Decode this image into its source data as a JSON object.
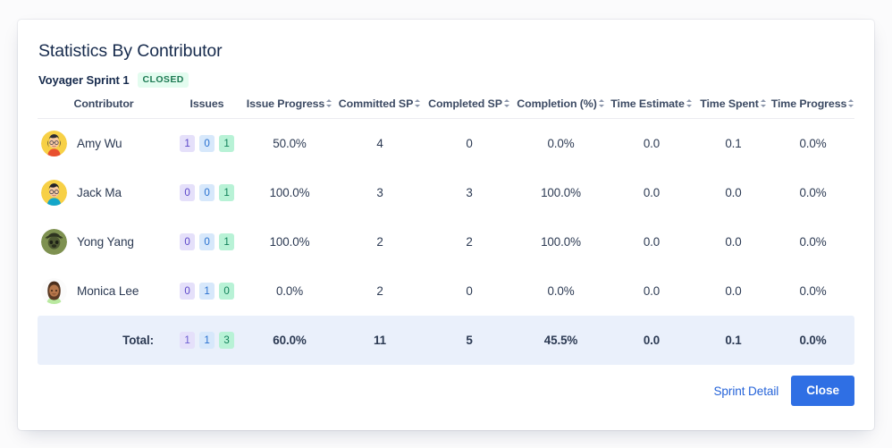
{
  "modal": {
    "title": "Statistics By Contributor",
    "sprint_name": "Voyager Sprint 1",
    "status_badge": "CLOSED",
    "status_badge_bg": "#e3fcef",
    "status_badge_color": "#1d7a53"
  },
  "table": {
    "columns": [
      {
        "label": "Contributor",
        "sortable": false
      },
      {
        "label": "Issues",
        "sortable": false
      },
      {
        "label": "Issue Progress",
        "sortable": true
      },
      {
        "label": "Committed SP",
        "sortable": true
      },
      {
        "label": "Completed SP",
        "sortable": true
      },
      {
        "label": "Completion (%)",
        "sortable": true
      },
      {
        "label": "Time Estimate",
        "sortable": true
      },
      {
        "label": "Time Spent",
        "sortable": true
      },
      {
        "label": "Time Progress",
        "sortable": true
      }
    ],
    "rows": [
      {
        "name": "Amy Wu",
        "avatar": "avatar-amy-wu",
        "issues": {
          "todo": "1",
          "in_progress": "0",
          "done": "1"
        },
        "issue_progress": "50.0%",
        "committed_sp": "4",
        "completed_sp": "0",
        "completion_pct": "0.0%",
        "time_estimate": "0.0",
        "time_spent": "0.1",
        "time_progress": "0.0%"
      },
      {
        "name": "Jack Ma",
        "avatar": "avatar-jack-ma",
        "issues": {
          "todo": "0",
          "in_progress": "0",
          "done": "1"
        },
        "issue_progress": "100.0%",
        "committed_sp": "3",
        "completed_sp": "3",
        "completion_pct": "100.0%",
        "time_estimate": "0.0",
        "time_spent": "0.0",
        "time_progress": "0.0%"
      },
      {
        "name": "Yong Yang",
        "avatar": "avatar-yong-yang",
        "issues": {
          "todo": "0",
          "in_progress": "0",
          "done": "1"
        },
        "issue_progress": "100.0%",
        "committed_sp": "2",
        "completed_sp": "2",
        "completion_pct": "100.0%",
        "time_estimate": "0.0",
        "time_spent": "0.0",
        "time_progress": "0.0%"
      },
      {
        "name": "Monica Lee",
        "avatar": "avatar-monica-lee",
        "issues": {
          "todo": "0",
          "in_progress": "1",
          "done": "0"
        },
        "issue_progress": "0.0%",
        "committed_sp": "2",
        "completed_sp": "0",
        "completion_pct": "0.0%",
        "time_estimate": "0.0",
        "time_spent": "0.0",
        "time_progress": "0.0%"
      }
    ],
    "total": {
      "label": "Total:",
      "issues": {
        "todo": "1",
        "in_progress": "1",
        "done": "3"
      },
      "issue_progress": "60.0%",
      "committed_sp": "11",
      "completed_sp": "5",
      "completion_pct": "45.5%",
      "time_estimate": "0.0",
      "time_spent": "0.1",
      "time_progress": "0.0%"
    }
  },
  "footer": {
    "sprint_detail_link": "Sprint Detail",
    "close_button": "Close",
    "primary_color": "#2f6fe4",
    "link_color": "#2563d9"
  },
  "badge_colors": {
    "todo": "#e5e0fa",
    "in_progress": "#d7e8fb",
    "done": "#b8f2d6"
  }
}
